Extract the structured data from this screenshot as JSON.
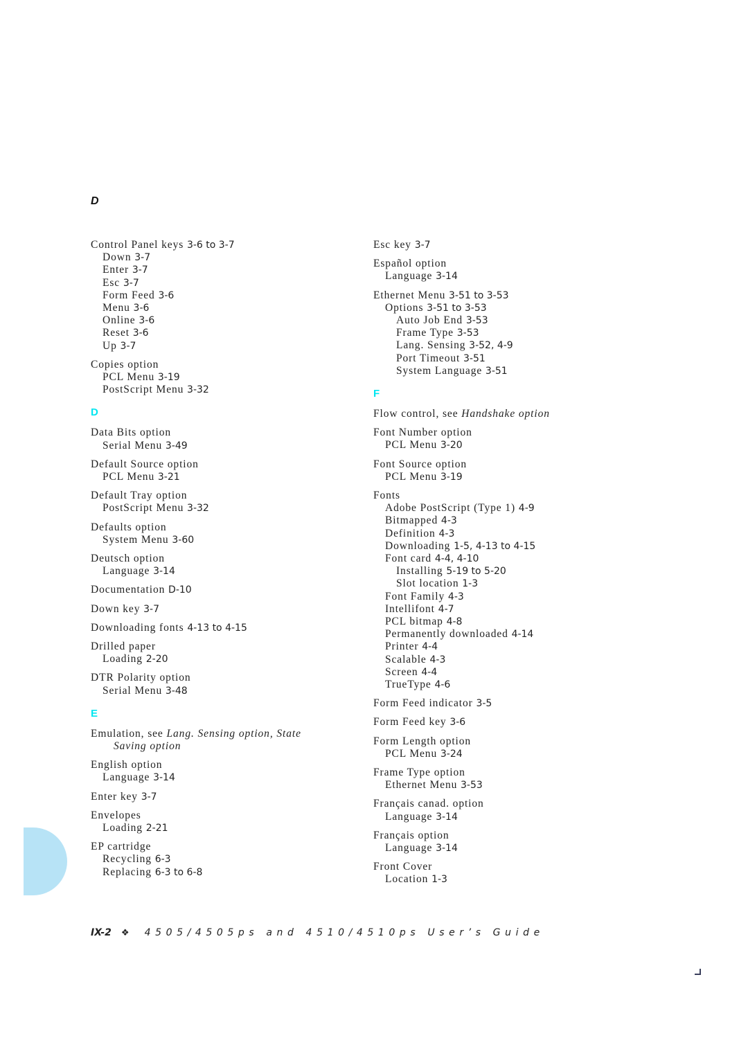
{
  "header": {
    "letter": "D"
  },
  "left_column": [
    {
      "kind": "entry",
      "level": 0,
      "text": "Control Panel keys ",
      "pages": "3-6 to 3-7"
    },
    {
      "kind": "entry",
      "level": 1,
      "text": "Down ",
      "pages": "3-7"
    },
    {
      "kind": "entry",
      "level": 1,
      "text": "Enter ",
      "pages": "3-7"
    },
    {
      "kind": "entry",
      "level": 1,
      "text": "Esc ",
      "pages": "3-7"
    },
    {
      "kind": "entry",
      "level": 1,
      "text": "Form Feed ",
      "pages": "3-6"
    },
    {
      "kind": "entry",
      "level": 1,
      "text": "Menu ",
      "pages": "3-6"
    },
    {
      "kind": "entry",
      "level": 1,
      "text": "Online ",
      "pages": "3-6"
    },
    {
      "kind": "entry",
      "level": 1,
      "text": "Reset ",
      "pages": "3-6"
    },
    {
      "kind": "entry",
      "level": 1,
      "text": "Up ",
      "pages": "3-7"
    },
    {
      "kind": "entry",
      "level": 0,
      "text": "Copies option",
      "pages": ""
    },
    {
      "kind": "entry",
      "level": 1,
      "text": "PCL Menu ",
      "pages": "3-19"
    },
    {
      "kind": "entry",
      "level": 1,
      "text": "PostScript Menu ",
      "pages": "3-32"
    },
    {
      "kind": "section",
      "text": "D"
    },
    {
      "kind": "entry",
      "level": 0,
      "text": "Data Bits option",
      "pages": ""
    },
    {
      "kind": "entry",
      "level": 1,
      "text": "Serial Menu ",
      "pages": "3-49"
    },
    {
      "kind": "entry",
      "level": 0,
      "text": "Default Source option",
      "pages": ""
    },
    {
      "kind": "entry",
      "level": 1,
      "text": "PCL Menu ",
      "pages": "3-21"
    },
    {
      "kind": "entry",
      "level": 0,
      "text": "Default Tray option",
      "pages": ""
    },
    {
      "kind": "entry",
      "level": 1,
      "text": "PostScript Menu ",
      "pages": "3-32"
    },
    {
      "kind": "entry",
      "level": 0,
      "text": "Defaults option",
      "pages": ""
    },
    {
      "kind": "entry",
      "level": 1,
      "text": "System Menu ",
      "pages": "3-60"
    },
    {
      "kind": "entry",
      "level": 0,
      "text": "Deutsch option",
      "pages": ""
    },
    {
      "kind": "entry",
      "level": 1,
      "text": "Language ",
      "pages": "3-14"
    },
    {
      "kind": "entry",
      "level": 0,
      "text": "Documentation ",
      "pages": "D-10"
    },
    {
      "kind": "entry",
      "level": 0,
      "text": "Down key ",
      "pages": "3-7"
    },
    {
      "kind": "entry",
      "level": 0,
      "text": "Downloading fonts ",
      "pages": "4-13 to 4-15"
    },
    {
      "kind": "entry",
      "level": 0,
      "text": "Drilled paper",
      "pages": ""
    },
    {
      "kind": "entry",
      "level": 1,
      "text": "Loading ",
      "pages": "2-20"
    },
    {
      "kind": "entry",
      "level": 0,
      "text": "DTR Polarity option",
      "pages": ""
    },
    {
      "kind": "entry",
      "level": 1,
      "text": "Serial Menu ",
      "pages": "3-48"
    },
    {
      "kind": "section",
      "text": "E"
    },
    {
      "kind": "entry",
      "level": 0,
      "text": "Emulation, see ",
      "italic": "Lang. Sensing option, State",
      "pages": ""
    },
    {
      "kind": "entry",
      "level": 2,
      "text": "",
      "italic": "Saving option",
      "pages": ""
    },
    {
      "kind": "entry",
      "level": 0,
      "text": "English option",
      "pages": ""
    },
    {
      "kind": "entry",
      "level": 1,
      "text": "Language ",
      "pages": "3-14"
    },
    {
      "kind": "entry",
      "level": 0,
      "text": "Enter key ",
      "pages": "3-7"
    },
    {
      "kind": "entry",
      "level": 0,
      "text": "Envelopes",
      "pages": ""
    },
    {
      "kind": "entry",
      "level": 1,
      "text": "Loading ",
      "pages": "2-21"
    },
    {
      "kind": "entry",
      "level": 0,
      "text": "EP cartridge",
      "pages": ""
    },
    {
      "kind": "entry",
      "level": 1,
      "text": "Recycling ",
      "pages": "6-3"
    },
    {
      "kind": "entry",
      "level": 1,
      "text": "Replacing ",
      "pages": "6-3 to 6-8"
    }
  ],
  "right_column": [
    {
      "kind": "entry",
      "level": 0,
      "text": "Esc key ",
      "pages": "3-7"
    },
    {
      "kind": "entry",
      "level": 0,
      "text": "Español option",
      "pages": ""
    },
    {
      "kind": "entry",
      "level": 1,
      "text": "Language ",
      "pages": "3-14"
    },
    {
      "kind": "entry",
      "level": 0,
      "text": "Ethernet Menu ",
      "pages": "3-51 to 3-53"
    },
    {
      "kind": "entry",
      "level": 1,
      "text": "Options ",
      "pages": "3-51 to 3-53"
    },
    {
      "kind": "entry",
      "level": 2,
      "text": "Auto Job End ",
      "pages": "3-53"
    },
    {
      "kind": "entry",
      "level": 2,
      "text": "Frame Type ",
      "pages": "3-53"
    },
    {
      "kind": "entry",
      "level": 2,
      "text": "Lang. Sensing ",
      "pages": "3-52, 4-9"
    },
    {
      "kind": "entry",
      "level": 2,
      "text": "Port Timeout ",
      "pages": "3-51"
    },
    {
      "kind": "entry",
      "level": 2,
      "text": "System Language ",
      "pages": "3-51"
    },
    {
      "kind": "section",
      "text": "F"
    },
    {
      "kind": "entry",
      "level": 0,
      "text": "Flow control, see ",
      "italic": "Handshake option",
      "pages": ""
    },
    {
      "kind": "entry",
      "level": 0,
      "text": "Font Number option",
      "pages": ""
    },
    {
      "kind": "entry",
      "level": 1,
      "text": "PCL Menu ",
      "pages": "3-20"
    },
    {
      "kind": "entry",
      "level": 0,
      "text": "Font Source option",
      "pages": ""
    },
    {
      "kind": "entry",
      "level": 1,
      "text": "PCL Menu ",
      "pages": "3-19"
    },
    {
      "kind": "entry",
      "level": 0,
      "text": "Fonts",
      "pages": ""
    },
    {
      "kind": "entry",
      "level": 1,
      "text": "Adobe PostScript (Type 1) ",
      "pages": "4-9"
    },
    {
      "kind": "entry",
      "level": 1,
      "text": "Bitmapped ",
      "pages": "4-3"
    },
    {
      "kind": "entry",
      "level": 1,
      "text": "Definition ",
      "pages": "4-3"
    },
    {
      "kind": "entry",
      "level": 1,
      "text": "Downloading ",
      "pages": "1-5, 4-13 to 4-15"
    },
    {
      "kind": "entry",
      "level": 1,
      "text": "Font card ",
      "pages": "4-4, 4-10"
    },
    {
      "kind": "entry",
      "level": 2,
      "text": "Installing ",
      "pages": "5-19 to 5-20"
    },
    {
      "kind": "entry",
      "level": 2,
      "text": "Slot location ",
      "pages": "1-3"
    },
    {
      "kind": "entry",
      "level": 1,
      "text": "Font Family ",
      "pages": "4-3"
    },
    {
      "kind": "entry",
      "level": 1,
      "text": "Intellifont ",
      "pages": "4-7"
    },
    {
      "kind": "entry",
      "level": 1,
      "text": "PCL bitmap ",
      "pages": "4-8"
    },
    {
      "kind": "entry",
      "level": 1,
      "text": "Permanently downloaded ",
      "pages": "4-14"
    },
    {
      "kind": "entry",
      "level": 1,
      "text": "Printer ",
      "pages": "4-4"
    },
    {
      "kind": "entry",
      "level": 1,
      "text": "Scalable ",
      "pages": "4-3"
    },
    {
      "kind": "entry",
      "level": 1,
      "text": "Screen ",
      "pages": "4-4"
    },
    {
      "kind": "entry",
      "level": 1,
      "text": "TrueType ",
      "pages": "4-6"
    },
    {
      "kind": "entry",
      "level": 0,
      "text": "Form Feed indicator ",
      "pages": "3-5"
    },
    {
      "kind": "entry",
      "level": 0,
      "text": "Form Feed key ",
      "pages": "3-6"
    },
    {
      "kind": "entry",
      "level": 0,
      "text": "Form Length option",
      "pages": ""
    },
    {
      "kind": "entry",
      "level": 1,
      "text": "PCL Menu ",
      "pages": "3-24"
    },
    {
      "kind": "entry",
      "level": 0,
      "text": "Frame Type option",
      "pages": ""
    },
    {
      "kind": "entry",
      "level": 1,
      "text": "Ethernet Menu ",
      "pages": "3-53"
    },
    {
      "kind": "entry",
      "level": 0,
      "text": "Français canad. option",
      "pages": ""
    },
    {
      "kind": "entry",
      "level": 1,
      "text": "Language ",
      "pages": "3-14"
    },
    {
      "kind": "entry",
      "level": 0,
      "text": "Français option",
      "pages": ""
    },
    {
      "kind": "entry",
      "level": 1,
      "text": "Language ",
      "pages": "3-14"
    },
    {
      "kind": "entry",
      "level": 0,
      "text": "Front Cover",
      "pages": ""
    },
    {
      "kind": "entry",
      "level": 1,
      "text": "Location ",
      "pages": "1-3"
    }
  ],
  "footer": {
    "page_number": "IX-2",
    "ornament": "❖",
    "title": "4505/4505ps and 4510/4510ps User’s Guide"
  },
  "colors": {
    "section_letter": "#00e6f0",
    "thumb_tab": "#b7e3f6",
    "text": "#222222"
  }
}
